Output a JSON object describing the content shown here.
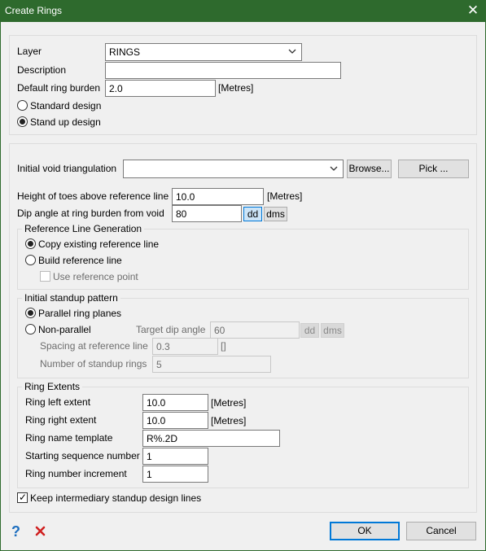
{
  "window": {
    "title": "Create Rings"
  },
  "top": {
    "layer_label": "Layer",
    "layer_value": "RINGS",
    "description_label": "Description",
    "description_value": "",
    "burden_label": "Default ring burden",
    "burden_value": "2.0",
    "burden_unit": "[Metres]",
    "standard_design_label": "Standard design",
    "standard_design_selected": false,
    "standup_design_label": "Stand up design",
    "standup_design_selected": true
  },
  "main": {
    "void_label": "Initial void triangulation",
    "void_value": "",
    "browse_label": "Browse...",
    "pick_label": "Pick ...",
    "toes_label": "Height of toes above reference line",
    "toes_value": "10.0",
    "toes_unit": "[Metres]",
    "dip_label": "Dip angle at ring burden from void",
    "dip_value": "80",
    "dd_label": "dd",
    "dms_label": "dms"
  },
  "refline": {
    "title": "Reference Line Generation",
    "copy_label": "Copy existing reference line",
    "copy_selected": true,
    "build_label": "Build reference line",
    "build_selected": false,
    "use_point_label": "Use reference point",
    "use_point_checked": false
  },
  "standup": {
    "title": "Initial standup pattern",
    "parallel_label": "Parallel ring planes",
    "parallel_selected": true,
    "nonparallel_label": "Non-parallel",
    "nonparallel_selected": false,
    "target_dip_label": "Target dip angle",
    "target_dip_value": "60",
    "dd_label": "dd",
    "dms_label": "dms",
    "spacing_label": "Spacing at reference line",
    "spacing_value": "0.3",
    "spacing_unit": "[]",
    "num_rings_label": "Number of standup rings",
    "num_rings_value": "5"
  },
  "extents": {
    "title": "Ring Extents",
    "left_label": "Ring left extent",
    "left_value": "10.0",
    "left_unit": "[Metres]",
    "right_label": "Ring right extent",
    "right_value": "10.0",
    "right_unit": "[Metres]",
    "template_label": "Ring name template",
    "template_value": "R%.2D",
    "start_seq_label": "Starting sequence number",
    "start_seq_value": "1",
    "increment_label": "Ring number increment",
    "increment_value": "1"
  },
  "keep_lines_label": "Keep intermediary standup design lines",
  "keep_lines_checked": true,
  "footer": {
    "ok_label": "OK",
    "cancel_label": "Cancel",
    "help_icon": "question-icon",
    "reset_icon": "red-x-icon"
  },
  "colors": {
    "titlebar": "#2e6a2d",
    "accent": "#0078d7",
    "help": "#1e6fbf",
    "reset": "#d02020"
  }
}
